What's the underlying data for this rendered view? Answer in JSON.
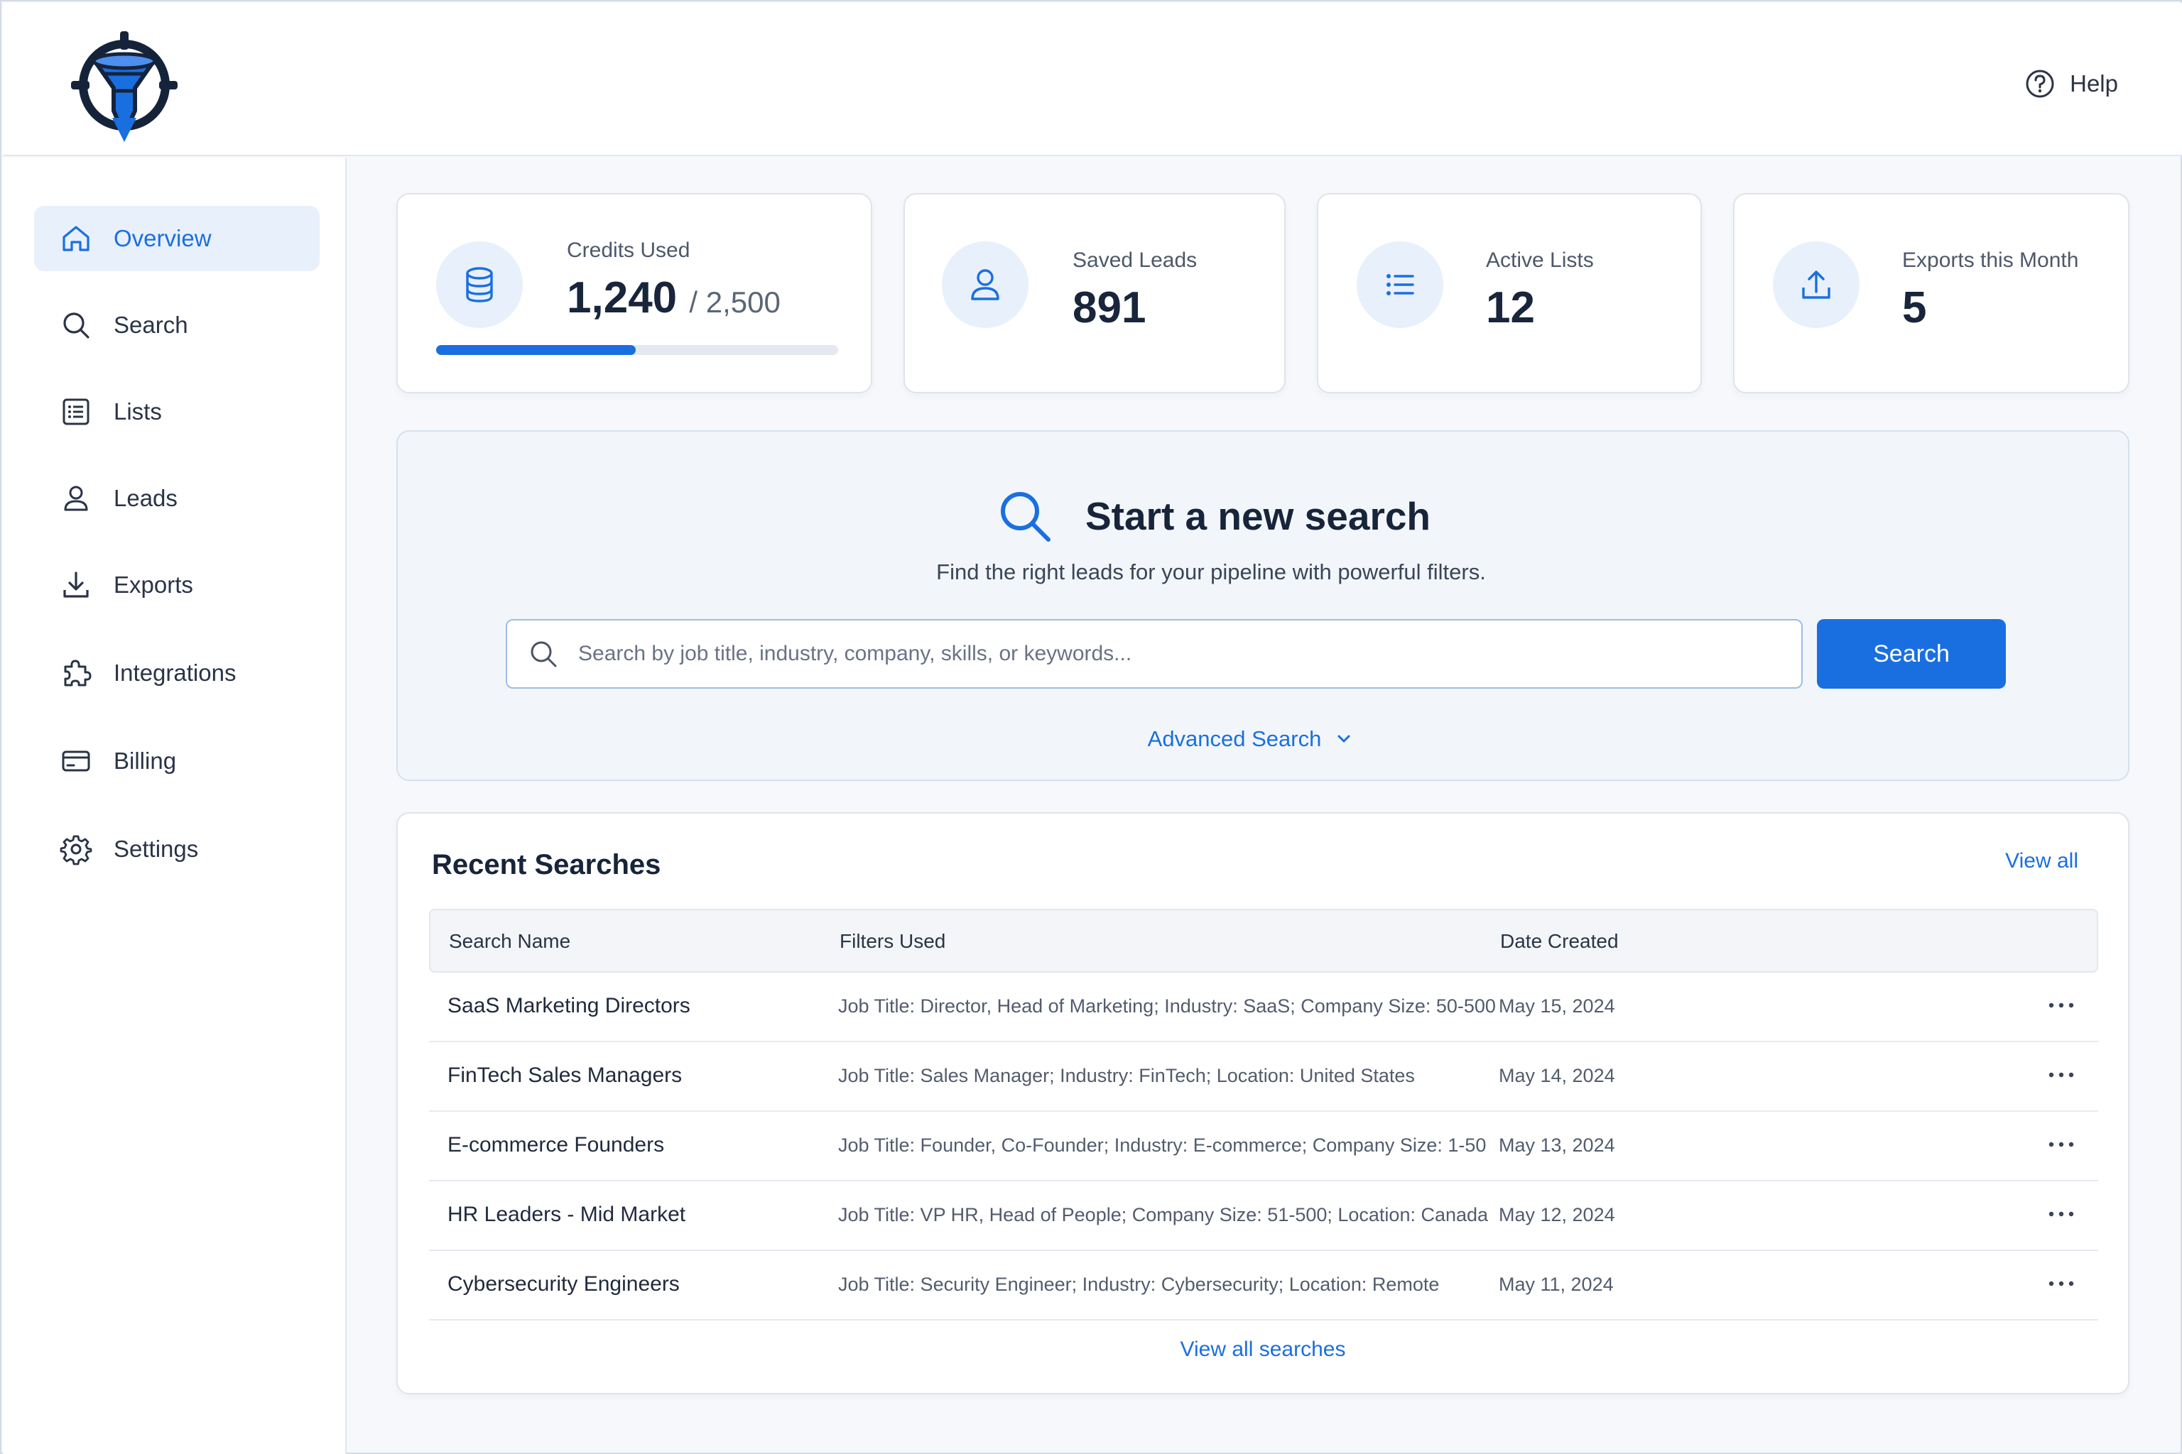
{
  "header": {
    "help_label": "Help"
  },
  "sidebar": {
    "items": [
      {
        "label": "Overview",
        "icon": "home-icon",
        "active": true
      },
      {
        "label": "Search",
        "icon": "search-icon"
      },
      {
        "label": "Lists",
        "icon": "list-icon"
      },
      {
        "label": "Leads",
        "icon": "user-icon"
      },
      {
        "label": "Exports",
        "icon": "download-icon"
      },
      {
        "label": "Integrations",
        "icon": "puzzle-icon"
      },
      {
        "label": "Billing",
        "icon": "credit-card-icon"
      },
      {
        "label": "Settings",
        "icon": "gear-icon"
      }
    ]
  },
  "stats": {
    "credits": {
      "label": "Credits Used",
      "value": "1,240",
      "total": "/ 2,500",
      "progress": 0.496,
      "icon": "database-icon"
    },
    "saved_leads": {
      "label": "Saved Leads",
      "value": "891",
      "icon": "user-icon"
    },
    "active_lists": {
      "label": "Active Lists",
      "value": "12",
      "icon": "list-icon"
    },
    "exports": {
      "label": "Exports this Month",
      "value": "5",
      "icon": "upload-icon"
    }
  },
  "search_panel": {
    "title": "Start a new search",
    "subtitle": "Find the right leads for your pipeline with powerful filters.",
    "placeholder": "Search by job title, industry, company, skills, or keywords...",
    "button_label": "Search",
    "advanced_label": "Advanced Search"
  },
  "recent": {
    "title": "Recent Searches",
    "view_all": "View all",
    "columns": [
      "Search Name",
      "Filters Used",
      "Date Created"
    ],
    "rows": [
      {
        "name": "SaaS Marketing Directors",
        "filters": "Job Title: Director, Head of Marketing; Industry: SaaS; Company Size: 50-500",
        "date": "May 15, 2024"
      },
      {
        "name": "FinTech Sales Managers",
        "filters": "Job Title: Sales Manager; Industry: FinTech; Location: United States",
        "date": "May 14, 2024"
      },
      {
        "name": "E-commerce Founders",
        "filters": "Job Title: Founder, Co-Founder; Industry: E-commerce; Company Size: 1-50",
        "date": "May 13, 2024"
      },
      {
        "name": "HR Leaders - Mid Market",
        "filters": "Job Title: VP HR, Head of People; Company Size: 51-500; Location: Canada",
        "date": "May 12, 2024"
      },
      {
        "name": "Cybersecurity Engineers",
        "filters": "Job Title: Security Engineer; Industry: Cybersecurity; Location: Remote",
        "date": "May 11, 2024"
      }
    ],
    "footer_link": "View all searches"
  },
  "colors": {
    "accent": "#1a6fe0",
    "accent_light": "#e8f0fc",
    "logo_dark": "#15233a"
  }
}
